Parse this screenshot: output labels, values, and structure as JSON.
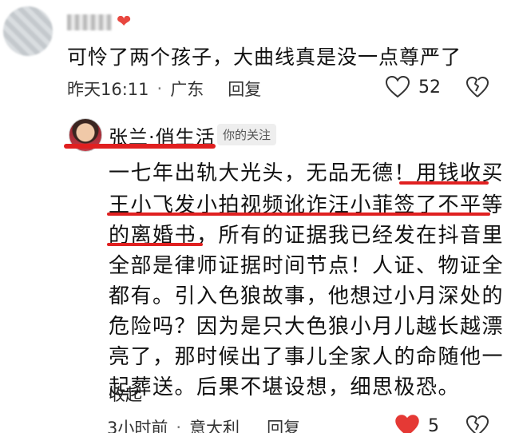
{
  "comment": {
    "username_blurred": true,
    "text": "可怜了两个孩子，大曲线真是没一点尊严了",
    "time": "昨天16:11",
    "location": "广东",
    "reply_label": "回复",
    "like_count": "52"
  },
  "reply": {
    "username": "张兰·俏生活",
    "follow_badge": "你的关注",
    "lines": [
      "一七年出轨大光头，无品无德！用钱收买",
      "王小飞发小拍视频讹诈汪小菲签了不平等",
      "的离婚书，所有的证据我已经发在抖音里",
      "全部是律师证据时间节点！人证、物证全",
      "都有。引入色狼故事，他想过小月深处的",
      "危险吗？因为是只大色狼小月儿越长越漂",
      "亮了，那时候出了事儿全家人的命随他一",
      "起葬送。后果不堪设想，细思极恐。"
    ],
    "collapse_label": "收起",
    "time": "3小时前",
    "location": "意大利",
    "reply_label": "回复",
    "like_count": "5",
    "liked": true
  },
  "colors": {
    "underline": "#e02020",
    "liked_heart": "#e53935"
  }
}
